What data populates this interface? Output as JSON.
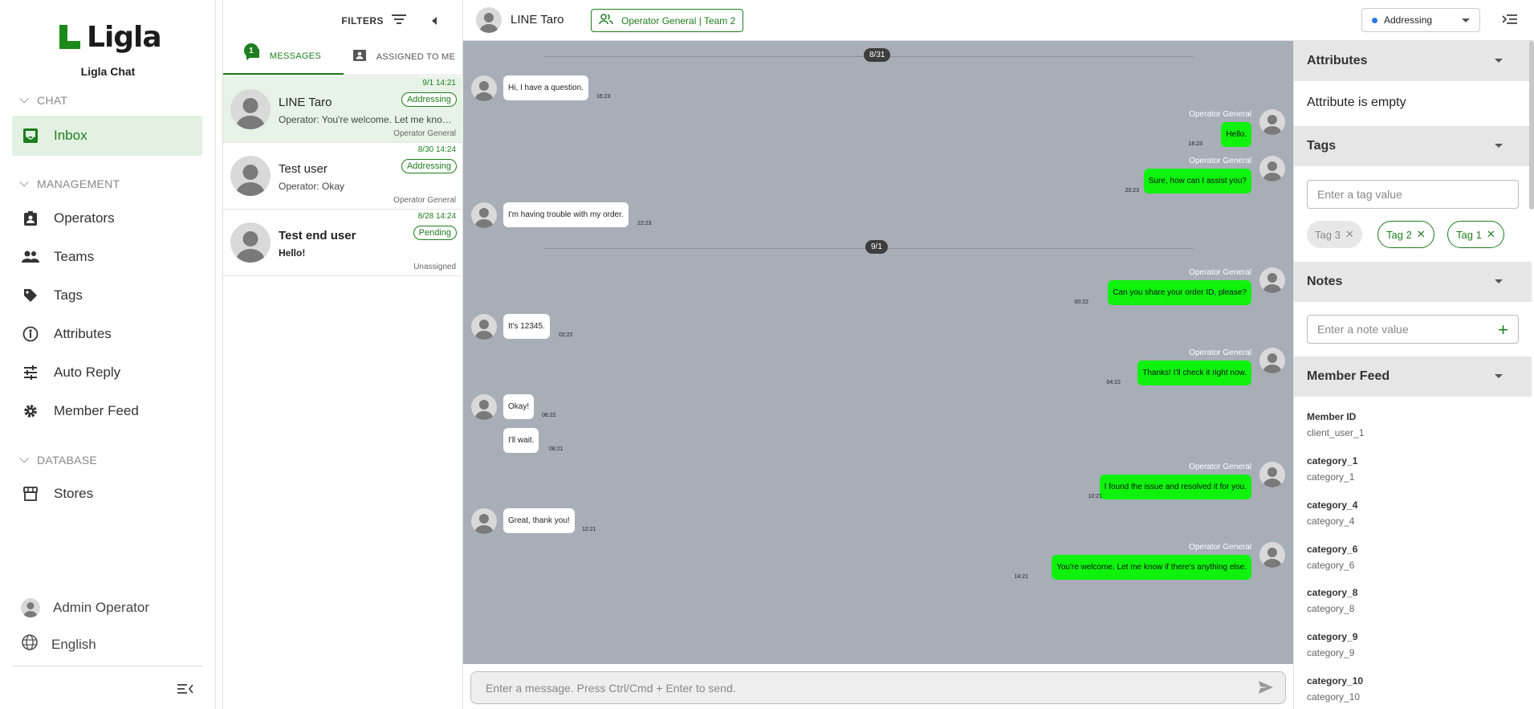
{
  "brand": {
    "logo_text": "Ligla",
    "app_name": "Ligla Chat",
    "accent": "#1e7d1e"
  },
  "nav": {
    "chat_section": "CHAT",
    "inbox": "Inbox",
    "management_section": "MANAGEMENT",
    "operators": "Operators",
    "teams": "Teams",
    "tags": "Tags",
    "attributes": "Attributes",
    "auto_reply": "Auto Reply",
    "member_feed": "Member Feed",
    "database_section": "DATABASE",
    "stores": "Stores",
    "user": "Admin Operator",
    "language": "English"
  },
  "list": {
    "filters_label": "FILTERS",
    "tabs": [
      {
        "label": "MESSAGES",
        "badge": "1"
      },
      {
        "label": "ASSIGNED TO ME"
      }
    ],
    "conversations": [
      {
        "date": "9/1 14:21",
        "name": "LINE Taro",
        "status": "Addressing",
        "preview": "Operator: You're welcome. Let me know if there's anything else.",
        "assignee": "Operator General"
      },
      {
        "date": "8/30 14:24",
        "name": "Test user",
        "status": "Addressing",
        "preview": "Operator: Okay",
        "assignee": "Operator General"
      },
      {
        "date": "8/28 14:24",
        "name": "Test end user",
        "status": "Pending",
        "preview": "Hello!",
        "assignee": "Unassigned"
      }
    ]
  },
  "chat": {
    "contact_name": "LINE Taro",
    "team_chip": "Operator General | Team 2",
    "status_value": "Addressing",
    "status_color": "#2b74e6",
    "date_separators": [
      "8/31",
      "9/1"
    ],
    "messages": [
      {
        "dir": "in",
        "text": "Hi, I have a question.",
        "time": "16:23"
      },
      {
        "dir": "out",
        "sender": "Operator General",
        "text": "Hello.",
        "time": "16:23"
      },
      {
        "dir": "out",
        "sender": "Operator General",
        "text": "Sure, how can I assist you?",
        "time": "20:23"
      },
      {
        "dir": "in",
        "text": "I'm having trouble with my order.",
        "time": "22:23"
      },
      {
        "dir": "out",
        "sender": "Operator General",
        "text": "Can you share your order ID, please?",
        "time": "00:22"
      },
      {
        "dir": "in",
        "text": "It's 12345.",
        "time": "02:22"
      },
      {
        "dir": "out",
        "sender": "Operator General",
        "text": "Thanks! I'll check it right now.",
        "time": "04:22"
      },
      {
        "dir": "in",
        "text": "Okay!",
        "time": "06:22"
      },
      {
        "dir": "in",
        "text": "I'll wait.",
        "time": "08:21"
      },
      {
        "dir": "out",
        "sender": "Operator General",
        "text": "I found the issue and resolved it for you.",
        "time": "10:21"
      },
      {
        "dir": "in",
        "text": "Great, thank you!",
        "time": "12:21"
      },
      {
        "dir": "out",
        "sender": "Operator General",
        "text": "You're welcome. Let me know if there's anything else.",
        "time": "14:21"
      }
    ],
    "composer_placeholder": "Enter a message. Press Ctrl/Cmd + Enter to send.",
    "outgoing_color": "#0ef20e",
    "background_color": "#a7aeb7"
  },
  "side": {
    "attributes_title": "Attributes",
    "attributes_empty": "Attribute is empty",
    "tags_title": "Tags",
    "tag_placeholder": "Enter a tag value",
    "tags": [
      {
        "label": "Tag 3",
        "state": "disabled"
      },
      {
        "label": "Tag 2",
        "state": "active"
      },
      {
        "label": "Tag 1",
        "state": "active"
      }
    ],
    "notes_title": "Notes",
    "note_placeholder": "Enter a note value",
    "member_feed_title": "Member Feed",
    "member_feed": [
      {
        "label": "Member ID",
        "value": "client_user_1"
      },
      {
        "label": "category_1",
        "value": "category_1"
      },
      {
        "label": "category_4",
        "value": "category_4"
      },
      {
        "label": "category_6",
        "value": "category_6"
      },
      {
        "label": "category_8",
        "value": "category_8"
      },
      {
        "label": "category_9",
        "value": "category_9"
      },
      {
        "label": "category_10",
        "value": "category_10"
      }
    ]
  }
}
